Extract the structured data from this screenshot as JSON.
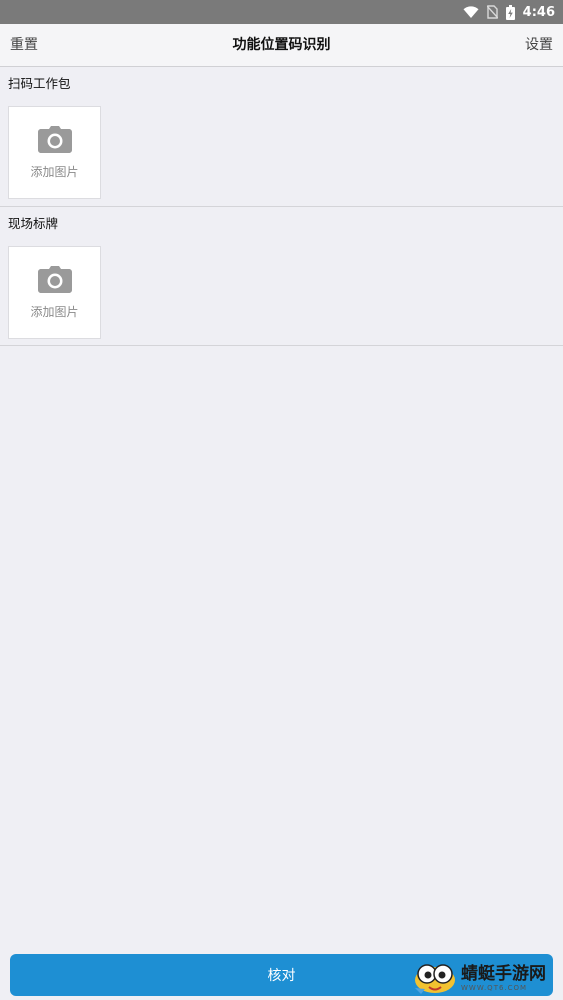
{
  "status_bar": {
    "time": "4:46",
    "icons": [
      "wifi-icon",
      "no-sim-icon",
      "battery-charging-icon"
    ]
  },
  "nav": {
    "left_label": "重置",
    "title": "功能位置码识别",
    "right_label": "设置"
  },
  "sections": [
    {
      "label": "扫码工作包",
      "add_photo_text": "添加图片",
      "icon": "camera-icon"
    },
    {
      "label": "现场标牌",
      "add_photo_text": "添加图片",
      "icon": "camera-icon"
    }
  ],
  "footer": {
    "verify_label": "核对"
  },
  "watermark": {
    "main": "蜻蜓手游网",
    "sub": "WWW.QT6.COM"
  },
  "colors": {
    "background": "#efeff4",
    "status_bar": "#7a7a7a",
    "primary_button": "#1e8fd3",
    "photo_box": "#ffffff"
  }
}
